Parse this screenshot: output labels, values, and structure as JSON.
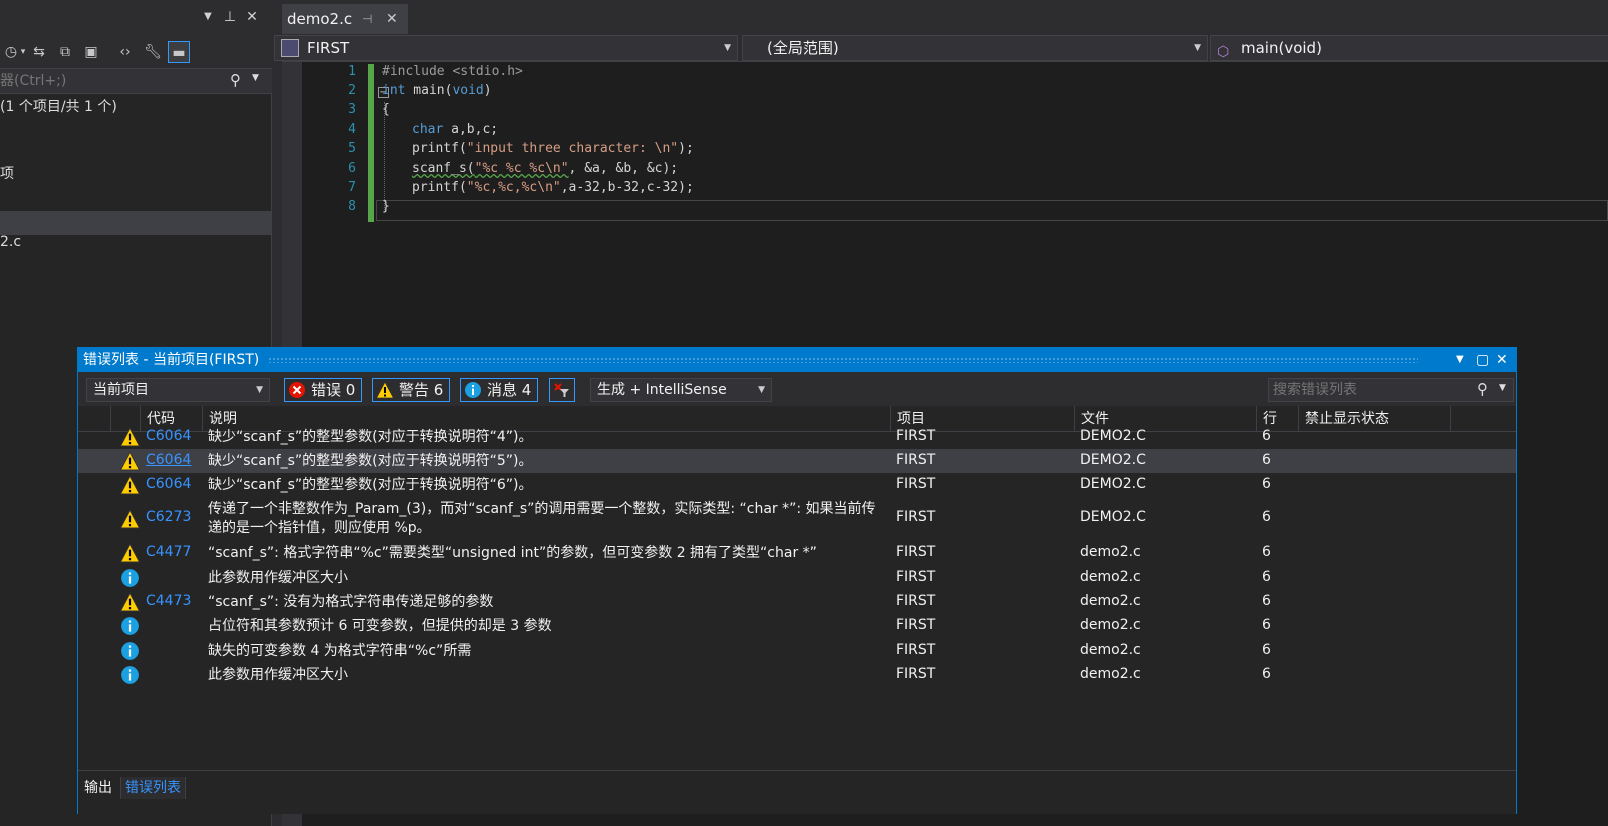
{
  "solution_explorer": {
    "search_placeholder": "器(Ctrl+;)",
    "tree": [
      {
        "label": "(1 个项目/共 1 个)"
      },
      {
        "label": "项"
      },
      {
        "label": "2.c"
      }
    ]
  },
  "editor": {
    "tab": {
      "label": "demo2.c"
    },
    "nav": {
      "project": "FIRST",
      "scope": "(全局范围)",
      "member": "main(void)"
    },
    "line_numbers": [
      "1",
      "2",
      "3",
      "4",
      "5",
      "6",
      "7",
      "8"
    ],
    "code": {
      "l1": "#include <stdio.h>",
      "l2_kw": "int",
      "l2_rest": " main(",
      "l2_void": "void",
      "l2_end": ")",
      "l3": "{",
      "l4_kw": "char",
      "l4_rest": " a,b,c;",
      "l5_fn": "printf(",
      "l5_str": "\"input three character: \\n\"",
      "l5_end": ");",
      "l6_fn": "scanf_s(",
      "l6_str": "\"%c %c %c\\n\"",
      "l6_end": ", &a, &b, &c);",
      "l7_fn": "printf(",
      "l7_str": "\"%c,%c,%c\\n\"",
      "l7_end": ",a-32,b-32,c-32);",
      "l8": "}"
    }
  },
  "error_list": {
    "title": "错误列表 - 当前项目(FIRST)",
    "scope_dropdown": "当前项目",
    "filters": {
      "errors": "错误 0",
      "warnings": "警告 6",
      "messages": "消息 4"
    },
    "build_dropdown": "生成 + IntelliSense",
    "search_placeholder": "搜索错误列表",
    "columns": {
      "code": "代码",
      "description": "说明",
      "project": "项目",
      "file": "文件",
      "line": "行",
      "suppression": "禁止显示状态"
    },
    "rows": [
      {
        "type": "warning",
        "code": "C6064",
        "desc": "缺少“scanf_s”的整型参数(对应于转换说明符“4”)。",
        "desc2": "",
        "project": "FIRST",
        "file": "DEMO2.C",
        "line": "6"
      },
      {
        "type": "warning",
        "code": "C6064",
        "desc": "缺少“scanf_s”的整型参数(对应于转换说明符“5”)。",
        "desc2": "",
        "project": "FIRST",
        "file": "DEMO2.C",
        "line": "6"
      },
      {
        "type": "warning",
        "code": "C6064",
        "desc": "缺少“scanf_s”的整型参数(对应于转换说明符“6”)。",
        "desc2": "",
        "project": "FIRST",
        "file": "DEMO2.C",
        "line": "6"
      },
      {
        "type": "warning",
        "code": "C6273",
        "desc": "传递了一个非整数作为_Param_(3)，而对“scanf_s”的调用需要一个整数，实际类型: “char *”: 如果当前传",
        "desc2": "递的是一个指针值，则应使用 %p。",
        "project": "FIRST",
        "file": "DEMO2.C",
        "line": "6"
      },
      {
        "type": "warning",
        "code": "C4477",
        "desc": "“scanf_s”: 格式字符串“%c”需要类型“unsigned int”的参数，但可变参数 2 拥有了类型“char *”",
        "desc2": "",
        "project": "FIRST",
        "file": "demo2.c",
        "line": "6"
      },
      {
        "type": "info",
        "code": "",
        "desc": "此参数用作缓冲区大小",
        "desc2": "",
        "project": "FIRST",
        "file": "demo2.c",
        "line": "6"
      },
      {
        "type": "warning",
        "code": "C4473",
        "desc": "“scanf_s”: 没有为格式字符串传递足够的参数",
        "desc2": "",
        "project": "FIRST",
        "file": "demo2.c",
        "line": "6"
      },
      {
        "type": "info",
        "code": "",
        "desc": "占位符和其参数预计 6 可变参数，但提供的却是 3 参数",
        "desc2": "",
        "project": "FIRST",
        "file": "demo2.c",
        "line": "6"
      },
      {
        "type": "info",
        "code": "",
        "desc": "缺失的可变参数 4 为格式字符串“%c”所需",
        "desc2": "",
        "project": "FIRST",
        "file": "demo2.c",
        "line": "6"
      },
      {
        "type": "info",
        "code": "",
        "desc": "此参数用作缓冲区大小",
        "desc2": "",
        "project": "FIRST",
        "file": "demo2.c",
        "line": "6"
      }
    ],
    "bottom_tabs": {
      "output": "输出",
      "error_list": "错误列表"
    }
  },
  "colors": {
    "accent": "#007acc",
    "warning": "#ffcc00",
    "error": "#e51400",
    "info": "#1ba1e2",
    "link": "#3794ff"
  }
}
